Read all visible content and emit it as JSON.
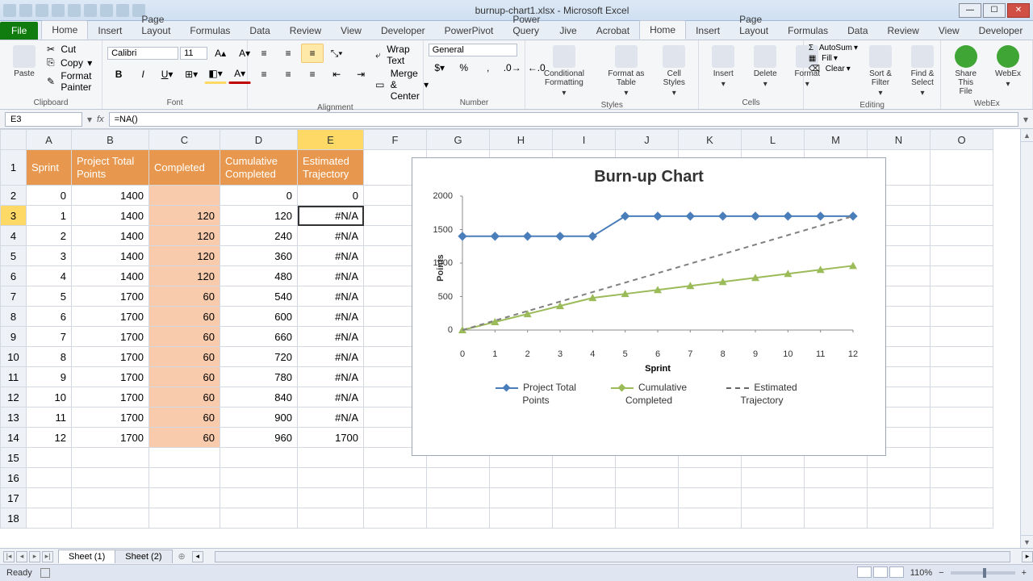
{
  "window": {
    "title": "burnup-chart1.xlsx - Microsoft Excel"
  },
  "ribbon": {
    "file": "File",
    "tabs": [
      "Home",
      "Insert",
      "Page Layout",
      "Formulas",
      "Data",
      "Review",
      "View",
      "Developer",
      "PowerPivot",
      "Power Query",
      "Jive",
      "Acrobat"
    ],
    "active_tab": "Home",
    "clipboard": {
      "paste": "Paste",
      "cut": "Cut",
      "copy": "Copy",
      "format_painter": "Format Painter",
      "label": "Clipboard"
    },
    "font": {
      "name": "Calibri",
      "size": "11",
      "label": "Font"
    },
    "alignment": {
      "wrap": "Wrap Text",
      "merge": "Merge & Center",
      "label": "Alignment"
    },
    "number": {
      "format": "General",
      "label": "Number"
    },
    "styles": {
      "cond": "Conditional Formatting",
      "table": "Format as Table",
      "cell": "Cell Styles",
      "label": "Styles"
    },
    "cells": {
      "insert": "Insert",
      "delete": "Delete",
      "format": "Format",
      "label": "Cells"
    },
    "editing": {
      "autosum": "AutoSum",
      "fill": "Fill",
      "clear": "Clear",
      "sort": "Sort & Filter",
      "find": "Find & Select",
      "label": "Editing"
    },
    "webex": {
      "share": "Share This File",
      "webex": "WebEx",
      "label": "WebEx"
    }
  },
  "formula_bar": {
    "namebox": "E3",
    "formula": "=NA()"
  },
  "columns": [
    "A",
    "B",
    "C",
    "D",
    "E",
    "F",
    "G",
    "H",
    "I",
    "J",
    "K",
    "L",
    "M",
    "N",
    "O"
  ],
  "headers": {
    "A": "Sprint",
    "B": "Project Total Points",
    "C": "Completed",
    "D": "Cumulative Completed",
    "E": "Estimated Trajectory"
  },
  "rows": [
    {
      "r": 2,
      "A": 0,
      "B": 1400,
      "C": "",
      "D": 0,
      "E": 0
    },
    {
      "r": 3,
      "A": 1,
      "B": 1400,
      "C": 120,
      "D": 120,
      "E": "#N/A"
    },
    {
      "r": 4,
      "A": 2,
      "B": 1400,
      "C": 120,
      "D": 240,
      "E": "#N/A"
    },
    {
      "r": 5,
      "A": 3,
      "B": 1400,
      "C": 120,
      "D": 360,
      "E": "#N/A"
    },
    {
      "r": 6,
      "A": 4,
      "B": 1400,
      "C": 120,
      "D": 480,
      "E": "#N/A"
    },
    {
      "r": 7,
      "A": 5,
      "B": 1700,
      "C": 60,
      "D": 540,
      "E": "#N/A"
    },
    {
      "r": 8,
      "A": 6,
      "B": 1700,
      "C": 60,
      "D": 600,
      "E": "#N/A"
    },
    {
      "r": 9,
      "A": 7,
      "B": 1700,
      "C": 60,
      "D": 660,
      "E": "#N/A"
    },
    {
      "r": 10,
      "A": 8,
      "B": 1700,
      "C": 60,
      "D": 720,
      "E": "#N/A"
    },
    {
      "r": 11,
      "A": 9,
      "B": 1700,
      "C": 60,
      "D": 780,
      "E": "#N/A"
    },
    {
      "r": 12,
      "A": 10,
      "B": 1700,
      "C": 60,
      "D": 840,
      "E": "#N/A"
    },
    {
      "r": 13,
      "A": 11,
      "B": 1700,
      "C": 60,
      "D": 900,
      "E": "#N/A"
    },
    {
      "r": 14,
      "A": 12,
      "B": 1700,
      "C": 60,
      "D": 960,
      "E": 1700
    }
  ],
  "empty_rows": [
    15,
    16,
    17,
    18
  ],
  "chart_data": {
    "type": "line",
    "title": "Burn-up Chart",
    "xlabel": "Sprint",
    "ylabel": "Points",
    "x": [
      0,
      1,
      2,
      3,
      4,
      5,
      6,
      7,
      8,
      9,
      10,
      11,
      12
    ],
    "xlim": [
      0,
      12
    ],
    "ylim": [
      0,
      2000
    ],
    "yticks": [
      0,
      500,
      1000,
      1500,
      2000
    ],
    "series": [
      {
        "name": "Project Total Points",
        "color": "#4a7ebb",
        "marker": "diamond",
        "values": [
          1400,
          1400,
          1400,
          1400,
          1400,
          1700,
          1700,
          1700,
          1700,
          1700,
          1700,
          1700,
          1700
        ]
      },
      {
        "name": "Cumulative Completed",
        "color": "#9bbb59",
        "marker": "triangle",
        "values": [
          0,
          120,
          240,
          360,
          480,
          540,
          600,
          660,
          720,
          780,
          840,
          900,
          960
        ]
      },
      {
        "name": "Estimated Trajectory",
        "color": "#7f7f7f",
        "dash": true,
        "values": [
          0,
          null,
          null,
          null,
          null,
          null,
          null,
          null,
          null,
          null,
          null,
          null,
          1700
        ]
      }
    ],
    "legend": [
      "Project Total Points",
      "Cumulative Completed",
      "Estimated Trajectory"
    ]
  },
  "sheets": {
    "active": "Sheet (1)",
    "tabs": [
      "Sheet (1)",
      "Sheet (2)"
    ]
  },
  "statusbar": {
    "ready": "Ready",
    "zoom": "110%"
  }
}
